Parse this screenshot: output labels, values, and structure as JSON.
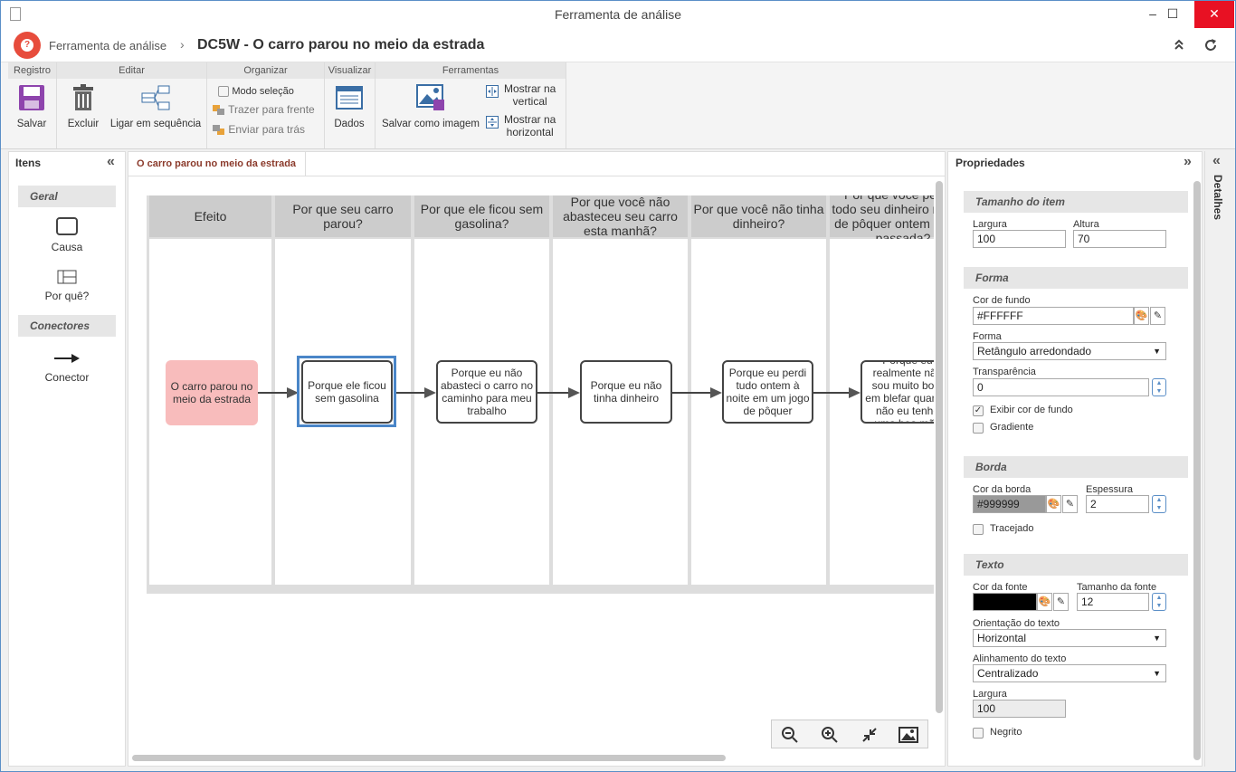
{
  "window": {
    "title": "Ferramenta de análise",
    "min": "–",
    "max": "☐",
    "close": "✕"
  },
  "header": {
    "breadcrumb_root": "Ferramenta de análise",
    "separator": "›",
    "title": "DC5W - O carro parou no meio da estrada"
  },
  "ribbon": {
    "groups": {
      "registro": "Registro",
      "editar": "Editar",
      "organizar": "Organizar",
      "visualizar": "Visualizar",
      "ferramentas": "Ferramentas"
    },
    "salvar": "Salvar",
    "excluir": "Excluir",
    "ligar": "Ligar em sequência",
    "modo_selecao": "Modo seleção",
    "trazer_frente": "Trazer para frente",
    "enviar_tras": "Enviar para trás",
    "dados": "Dados",
    "salvar_imagem": "Salvar como imagem",
    "mostrar_vertical": [
      "Mostrar na",
      "vertical"
    ],
    "mostrar_horizontal": [
      "Mostrar na",
      "horizontal"
    ]
  },
  "items_panel": {
    "title": "Itens",
    "collapse": "«",
    "sections": {
      "geral": "Geral",
      "conectores": "Conectores"
    },
    "causa": "Causa",
    "porque": "Por quê?",
    "conector": "Conector"
  },
  "canvas": {
    "tab": "O carro parou no meio da estrada",
    "columns": [
      "Efeito",
      "Por que seu carro parou?",
      "Por que ele ficou sem gasolina?",
      "Por que você não abasteceu seu carro esta manhã?",
      "Por que você não tinha dinheiro?",
      "Por que você perdeu todo seu dinheiro no jogo de pôquer ontem à noite passada?"
    ],
    "nodes": [
      "O carro parou no meio da estrada",
      "Porque ele ficou sem gasolina",
      "Porque eu não abasteci o carro no caminho para meu trabalho",
      "Porque eu não tinha dinheiro",
      "Porque eu perdi tudo ontem à noite em um jogo de pôquer",
      "Porque eu realmente não sou muito bom em blefar quando não eu tenho uma boa mão"
    ],
    "effect_color": "#f8bcbc",
    "selected_color": "#4a86c8"
  },
  "properties": {
    "title": "Propriedades",
    "collapse": "»",
    "tamanho": {
      "title": "Tamanho do item",
      "largura_label": "Largura",
      "largura": "100",
      "altura_label": "Altura",
      "altura": "70"
    },
    "forma": {
      "title": "Forma",
      "cor_fundo_label": "Cor de fundo",
      "cor_fundo": "#FFFFFF",
      "forma_label": "Forma",
      "forma": "Retângulo arredondado",
      "transparencia_label": "Transparência",
      "transparencia": "0",
      "exibir_cor": "Exibir cor de fundo",
      "gradiente": "Gradiente"
    },
    "borda": {
      "title": "Borda",
      "cor_label": "Cor da borda",
      "cor": "#999999",
      "espessura_label": "Espessura",
      "espessura": "2",
      "tracejado": "Tracejado"
    },
    "texto": {
      "title": "Texto",
      "cor_fonte_label": "Cor da fonte",
      "tamanho_label": "Tamanho da fonte",
      "tamanho": "12",
      "orientacao_label": "Orientação do texto",
      "orientacao": "Horizontal",
      "alinhamento_label": "Alinhamento do texto",
      "alinhamento": "Centralizado",
      "largura_label": "Largura",
      "largura": "100",
      "negrito": "Negrito"
    }
  },
  "details": {
    "label": "Detalhes",
    "collapse": "«"
  }
}
